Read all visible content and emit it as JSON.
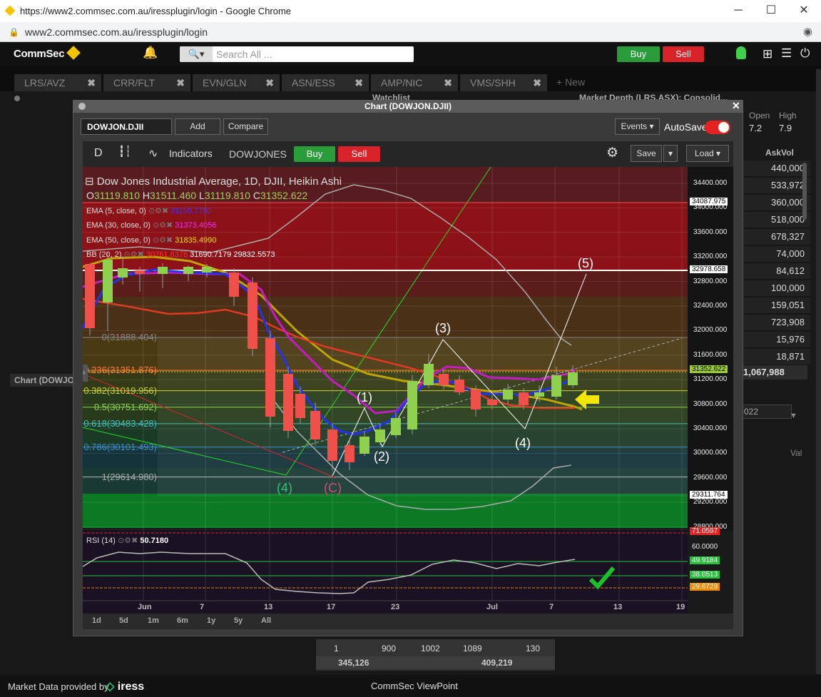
{
  "browser": {
    "title": "https://www2.commsec.com.au/iressplugin/login - Google Chrome",
    "url": "www2.commsec.com.au/iressplugin/login",
    "minimize": "─",
    "maximize": "☐",
    "close": "✕"
  },
  "app": {
    "logo": "CommSec",
    "search_placeholder": "Search All ...",
    "buy": "Buy",
    "sell": "Sell"
  },
  "tabs": [
    {
      "label": "LRS/AVZ"
    },
    {
      "label": "CRR/FLT"
    },
    {
      "label": "EVN/GLN"
    },
    {
      "label": "ASN/ESS"
    },
    {
      "label": "AMP/NIC"
    },
    {
      "label": "VMS/SHH"
    },
    {
      "label": "+ New"
    }
  ],
  "background": {
    "watchlist": "Watchlist",
    "market_depth": "Market Depth (LRS.ASX): Consolid...",
    "open_label": "Open",
    "high_label": "High",
    "open_val": "7.2",
    "high_val": "7.9",
    "askvol_label": "AskVol",
    "askvol": [
      "440,000",
      "533,972",
      "360,000",
      "518,000",
      "678,327",
      "74,000",
      "84,612",
      "100,000",
      "159,051",
      "723,908",
      "15,976",
      "18,871"
    ],
    "total": "1,067,988",
    "date_frag": "022",
    "val_label": "Val",
    "side_label": "Chart (DOWJO",
    "bottom_row1": [
      "1",
      "900",
      "1002",
      "1089",
      "130"
    ],
    "bottom_row2": [
      "345,126",
      "409,219"
    ]
  },
  "modal": {
    "title": "Chart (DOWJON.DJII)",
    "close": "✕",
    "symbol": "DOWJON.DJII",
    "add": "Add",
    "compare": "Compare",
    "events": "Events ▾",
    "autosave": "AutoSave"
  },
  "toolbar": {
    "interval": "D",
    "indicators": "Indicators",
    "symbol_name": "DOWJONES",
    "buy": "Buy",
    "sell": "Sell",
    "save": "Save",
    "load": "Load ▾"
  },
  "chart": {
    "title": "Dow Jones Industrial Average, 1D, DJII, Heikin Ashi",
    "ohlc": {
      "o": "31119.810",
      "h": "31511.460",
      "l": "31119.810",
      "c": "31352.622"
    },
    "indicators": [
      {
        "label": "EMA (5, close, 0)",
        "value": "31158.7780",
        "color": "#2f2fff"
      },
      {
        "label": "EMA (30, close, 0)",
        "value": "31373.4056",
        "color": "#e41ee4"
      },
      {
        "label": "EMA (50, close, 0)",
        "value": "31835.4990",
        "color": "#e8d000"
      },
      {
        "label": "BB (20, 2)",
        "value": "30761.6376",
        "value2": "31690.7179",
        "value3": "29832.5573",
        "color": "#e22"
      }
    ],
    "y_ticks": [
      "34400.000",
      "34000.000",
      "33600.000",
      "33200.000",
      "32800.000",
      "32400.000",
      "32000.000",
      "31600.000",
      "31200.000",
      "30800.000",
      "30400.000",
      "30000.000",
      "29600.000",
      "29200.000",
      "28800.000"
    ],
    "price_tags": [
      {
        "v": "34087.975",
        "style": "white"
      },
      {
        "v": "32978.658",
        "style": "white"
      },
      {
        "v": "31352.622",
        "style": "yellowgreen"
      },
      {
        "v": "29311.764",
        "style": "white"
      }
    ],
    "fib": [
      {
        "l": "0(31888.404)"
      },
      {
        "l": "0.236(31351.876)"
      },
      {
        "l": "0.382(31019.956)"
      },
      {
        "l": "0.5(30751.692)"
      },
      {
        "l": "0.618(30483.428)"
      },
      {
        "l": "0.786(30101.493)"
      },
      {
        "l": "1(29614.980)"
      }
    ],
    "waves": [
      "(1)",
      "(2)",
      "(3)",
      "(4)",
      "(5)",
      "(4)",
      "(C)"
    ],
    "x_ticks": [
      "Jun",
      "7",
      "13",
      "17",
      "23",
      "Jul",
      "7",
      "13",
      "19"
    ],
    "rsi": {
      "label": "RSI (14)",
      "value": "50.7180",
      "levels": [
        "71.0597",
        "60.0000",
        "49.9184",
        "38.0513",
        "29.6729"
      ]
    },
    "periods": [
      "1d",
      "5d",
      "1m",
      "6m",
      "1y",
      "5y",
      "All"
    ]
  },
  "footer": {
    "provider": "Market Data provided by",
    "brand": "iress",
    "center": "CommSec ViewPoint"
  },
  "colors": {
    "green": "#2a9d3a",
    "red": "#d8232a",
    "bull_candle": "#8fd14f",
    "bear_candle": "#f0504a"
  }
}
